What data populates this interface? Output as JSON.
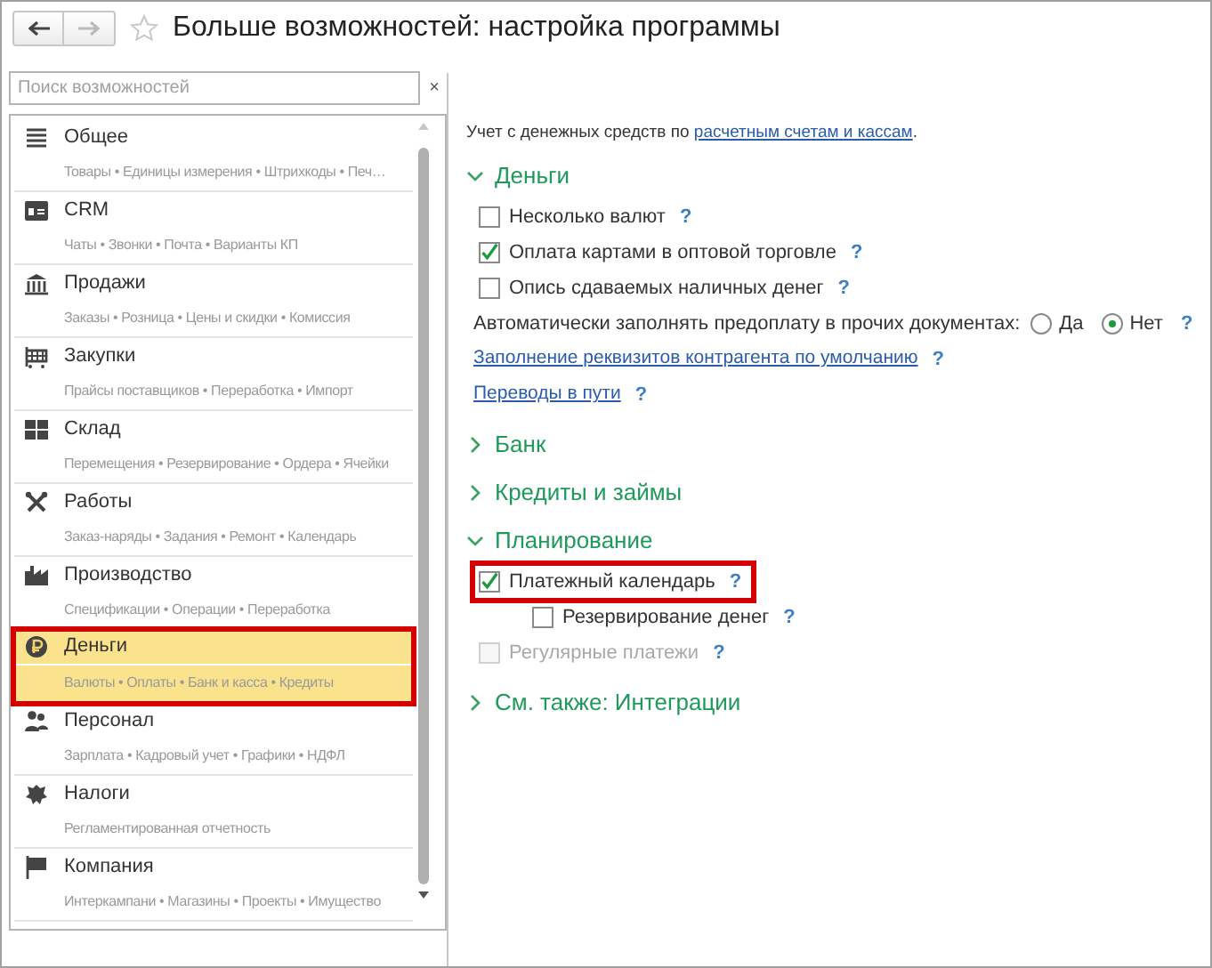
{
  "window": {
    "title": "Больше возможностей: настройка программы",
    "back_enabled": true,
    "forward_enabled": false,
    "favorite": false
  },
  "search": {
    "placeholder": "Поиск возможностей",
    "clear": "×"
  },
  "sidebar": {
    "items": [
      {
        "title": "Общее",
        "subtitle": "Товары • Единицы измерения • Штрихкоды • Печ…",
        "selected": false,
        "highlighted": false
      },
      {
        "title": "CRM",
        "subtitle": "Чаты • Звонки • Почта • Варианты КП",
        "selected": false,
        "highlighted": false
      },
      {
        "title": "Продажи",
        "subtitle": "Заказы • Розница • Цены и скидки • Комиссия",
        "selected": false,
        "highlighted": false
      },
      {
        "title": "Закупки",
        "subtitle": "Прайсы поставщиков • Переработка • Импорт",
        "selected": false,
        "highlighted": false
      },
      {
        "title": "Склад",
        "subtitle": "Перемещения • Резервирование • Ордера • Ячейки",
        "selected": false,
        "highlighted": false
      },
      {
        "title": "Работы",
        "subtitle": "Заказ-наряды • Задания • Ремонт • Календарь",
        "selected": false,
        "highlighted": false
      },
      {
        "title": "Производство",
        "subtitle": "Спецификации • Операции • Переработка",
        "selected": false,
        "highlighted": false
      },
      {
        "title": "Деньги",
        "subtitle": "Валюты • Оплаты • Банк и касса • Кредиты",
        "selected": true,
        "highlighted": true
      },
      {
        "title": "Персонал",
        "subtitle": "Зарплата • Кадровый учет • Графики • НДФЛ",
        "selected": false,
        "highlighted": false
      },
      {
        "title": "Налоги",
        "subtitle": "Регламентированная отчетность",
        "selected": false,
        "highlighted": false
      },
      {
        "title": "Компания",
        "subtitle": "Интеркампани • Магазины • Проекты • Имущество",
        "selected": false,
        "highlighted": false
      }
    ]
  },
  "content": [
    {
      "kind": "note",
      "text": "Учет с денежных средств по ",
      "link": "расчетным счетам и кассам",
      "after": "."
    },
    {
      "kind": "section",
      "title": "Деньги",
      "expanded": true,
      "items": [
        {
          "kind": "checkbox",
          "label": "Несколько валют",
          "checked": false,
          "disabled": false,
          "highlighted": false,
          "help": "?"
        },
        {
          "kind": "checkbox",
          "label": "Оплата картами в оптовой торговле",
          "checked": true,
          "disabled": false,
          "highlighted": false,
          "help": "?"
        },
        {
          "kind": "checkbox",
          "label": "Опись сдаваемых наличных денег",
          "checked": false,
          "disabled": false,
          "highlighted": false,
          "help": "?"
        },
        {
          "kind": "radio",
          "label": "Автоматически заполнять предоплату в прочих документах:",
          "options": [
            {
              "label": "Да",
              "selected": false
            },
            {
              "label": "Нет",
              "selected": true
            }
          ],
          "help": "?"
        },
        {
          "kind": "link",
          "label": "Заполнение реквизитов контрагента по умолчанию",
          "help": "?"
        },
        {
          "kind": "link",
          "label": "Переводы в пути",
          "help": "?"
        }
      ]
    },
    {
      "kind": "section",
      "title": "Банк",
      "expanded": false
    },
    {
      "kind": "section",
      "title": "Кредиты и займы",
      "expanded": false
    },
    {
      "kind": "section",
      "title": "Планирование",
      "expanded": true,
      "items": [
        {
          "kind": "checkbox",
          "label": "Платежный календарь",
          "checked": true,
          "disabled": false,
          "highlighted": true,
          "help": "?",
          "children": [
            {
              "kind": "checkbox",
              "label": "Резервирование денег",
              "checked": false,
              "disabled": false,
              "highlighted": false,
              "help": "?"
            }
          ]
        },
        {
          "kind": "checkbox",
          "label": "Регулярные платежи",
          "checked": false,
          "disabled": true,
          "highlighted": false,
          "help": "?"
        }
      ]
    },
    {
      "kind": "section",
      "title": "См. также: Интеграции",
      "expanded": false
    }
  ]
}
